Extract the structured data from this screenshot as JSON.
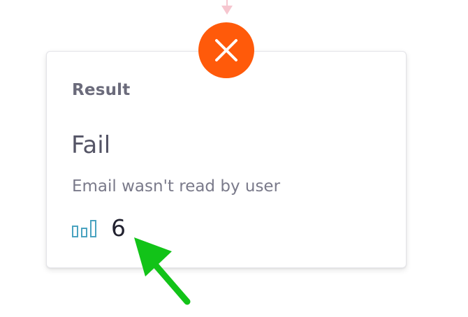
{
  "card": {
    "title": "Result",
    "outcome": "Fail",
    "description": "Email wasn't read by user",
    "count": "6"
  },
  "badge": {
    "icon": "close-icon",
    "color": "#ff5a0a",
    "status": "fail"
  },
  "icons": {
    "stats": "bar-chart-icon",
    "connector": "arrow-down-icon",
    "annotation": "green-arrow-icon"
  },
  "colors": {
    "connector": "#f6c6cf",
    "stats_icon": "#4aa3c0",
    "annotation": "#12c318"
  }
}
